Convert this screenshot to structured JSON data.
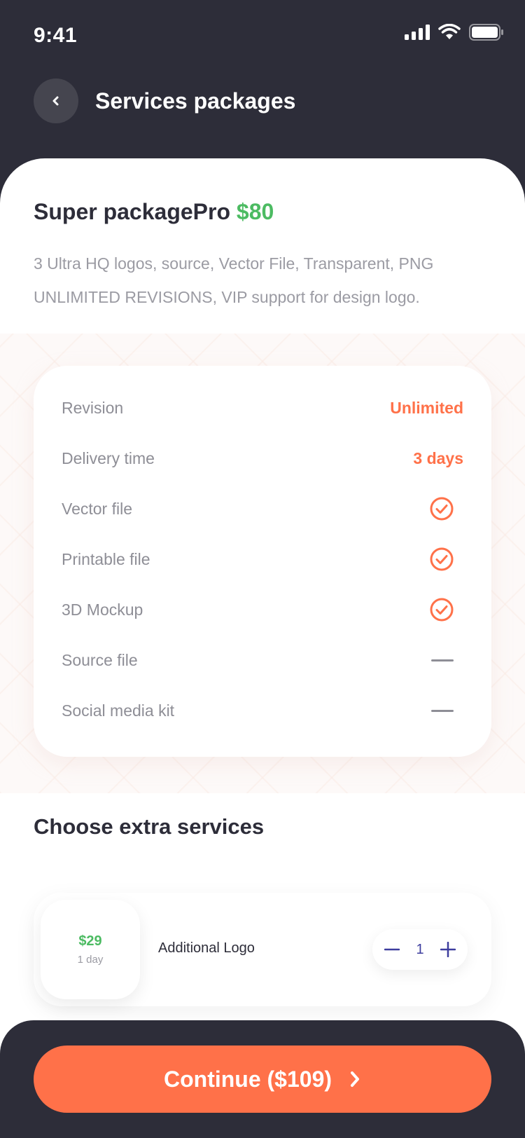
{
  "status_bar": {
    "time": "9:41"
  },
  "header": {
    "title": "Services packages"
  },
  "package": {
    "name": "Super packagePro",
    "price": "$80",
    "description_line1": "3 Ultra HQ logos, source, Vector File, Transparent, PNG",
    "description_line2": "UNLIMITED REVISIONS, VIP support for design logo."
  },
  "features": [
    {
      "label": "Revision",
      "type": "text",
      "value": "Unlimited"
    },
    {
      "label": "Delivery time",
      "type": "text",
      "value": "3 days"
    },
    {
      "label": "Vector file",
      "type": "check",
      "value": "included"
    },
    {
      "label": "Printable file",
      "type": "check",
      "value": "included"
    },
    {
      "label": "3D Mockup",
      "type": "check",
      "value": "included"
    },
    {
      "label": "Source file",
      "type": "dash",
      "value": "not-included"
    },
    {
      "label": "Social media kit",
      "type": "dash",
      "value": "not-included"
    }
  ],
  "extras": {
    "title": "Choose extra services",
    "items": [
      {
        "price": "$29",
        "duration": "1 day",
        "name": "Additional Logo",
        "quantity": "1"
      }
    ]
  },
  "footer": {
    "continue_label": "Continue ($109)"
  },
  "colors": {
    "dark": "#2d2d39",
    "accent": "#ff7149",
    "green": "#4cbb62",
    "stepper": "#3d3d9e"
  },
  "icons": {
    "back": "chevron-left-icon",
    "check": "check-circle-icon",
    "dash": "dash-icon",
    "minus": "minus-icon",
    "plus": "plus-icon",
    "continue": "chevron-right-icon"
  }
}
